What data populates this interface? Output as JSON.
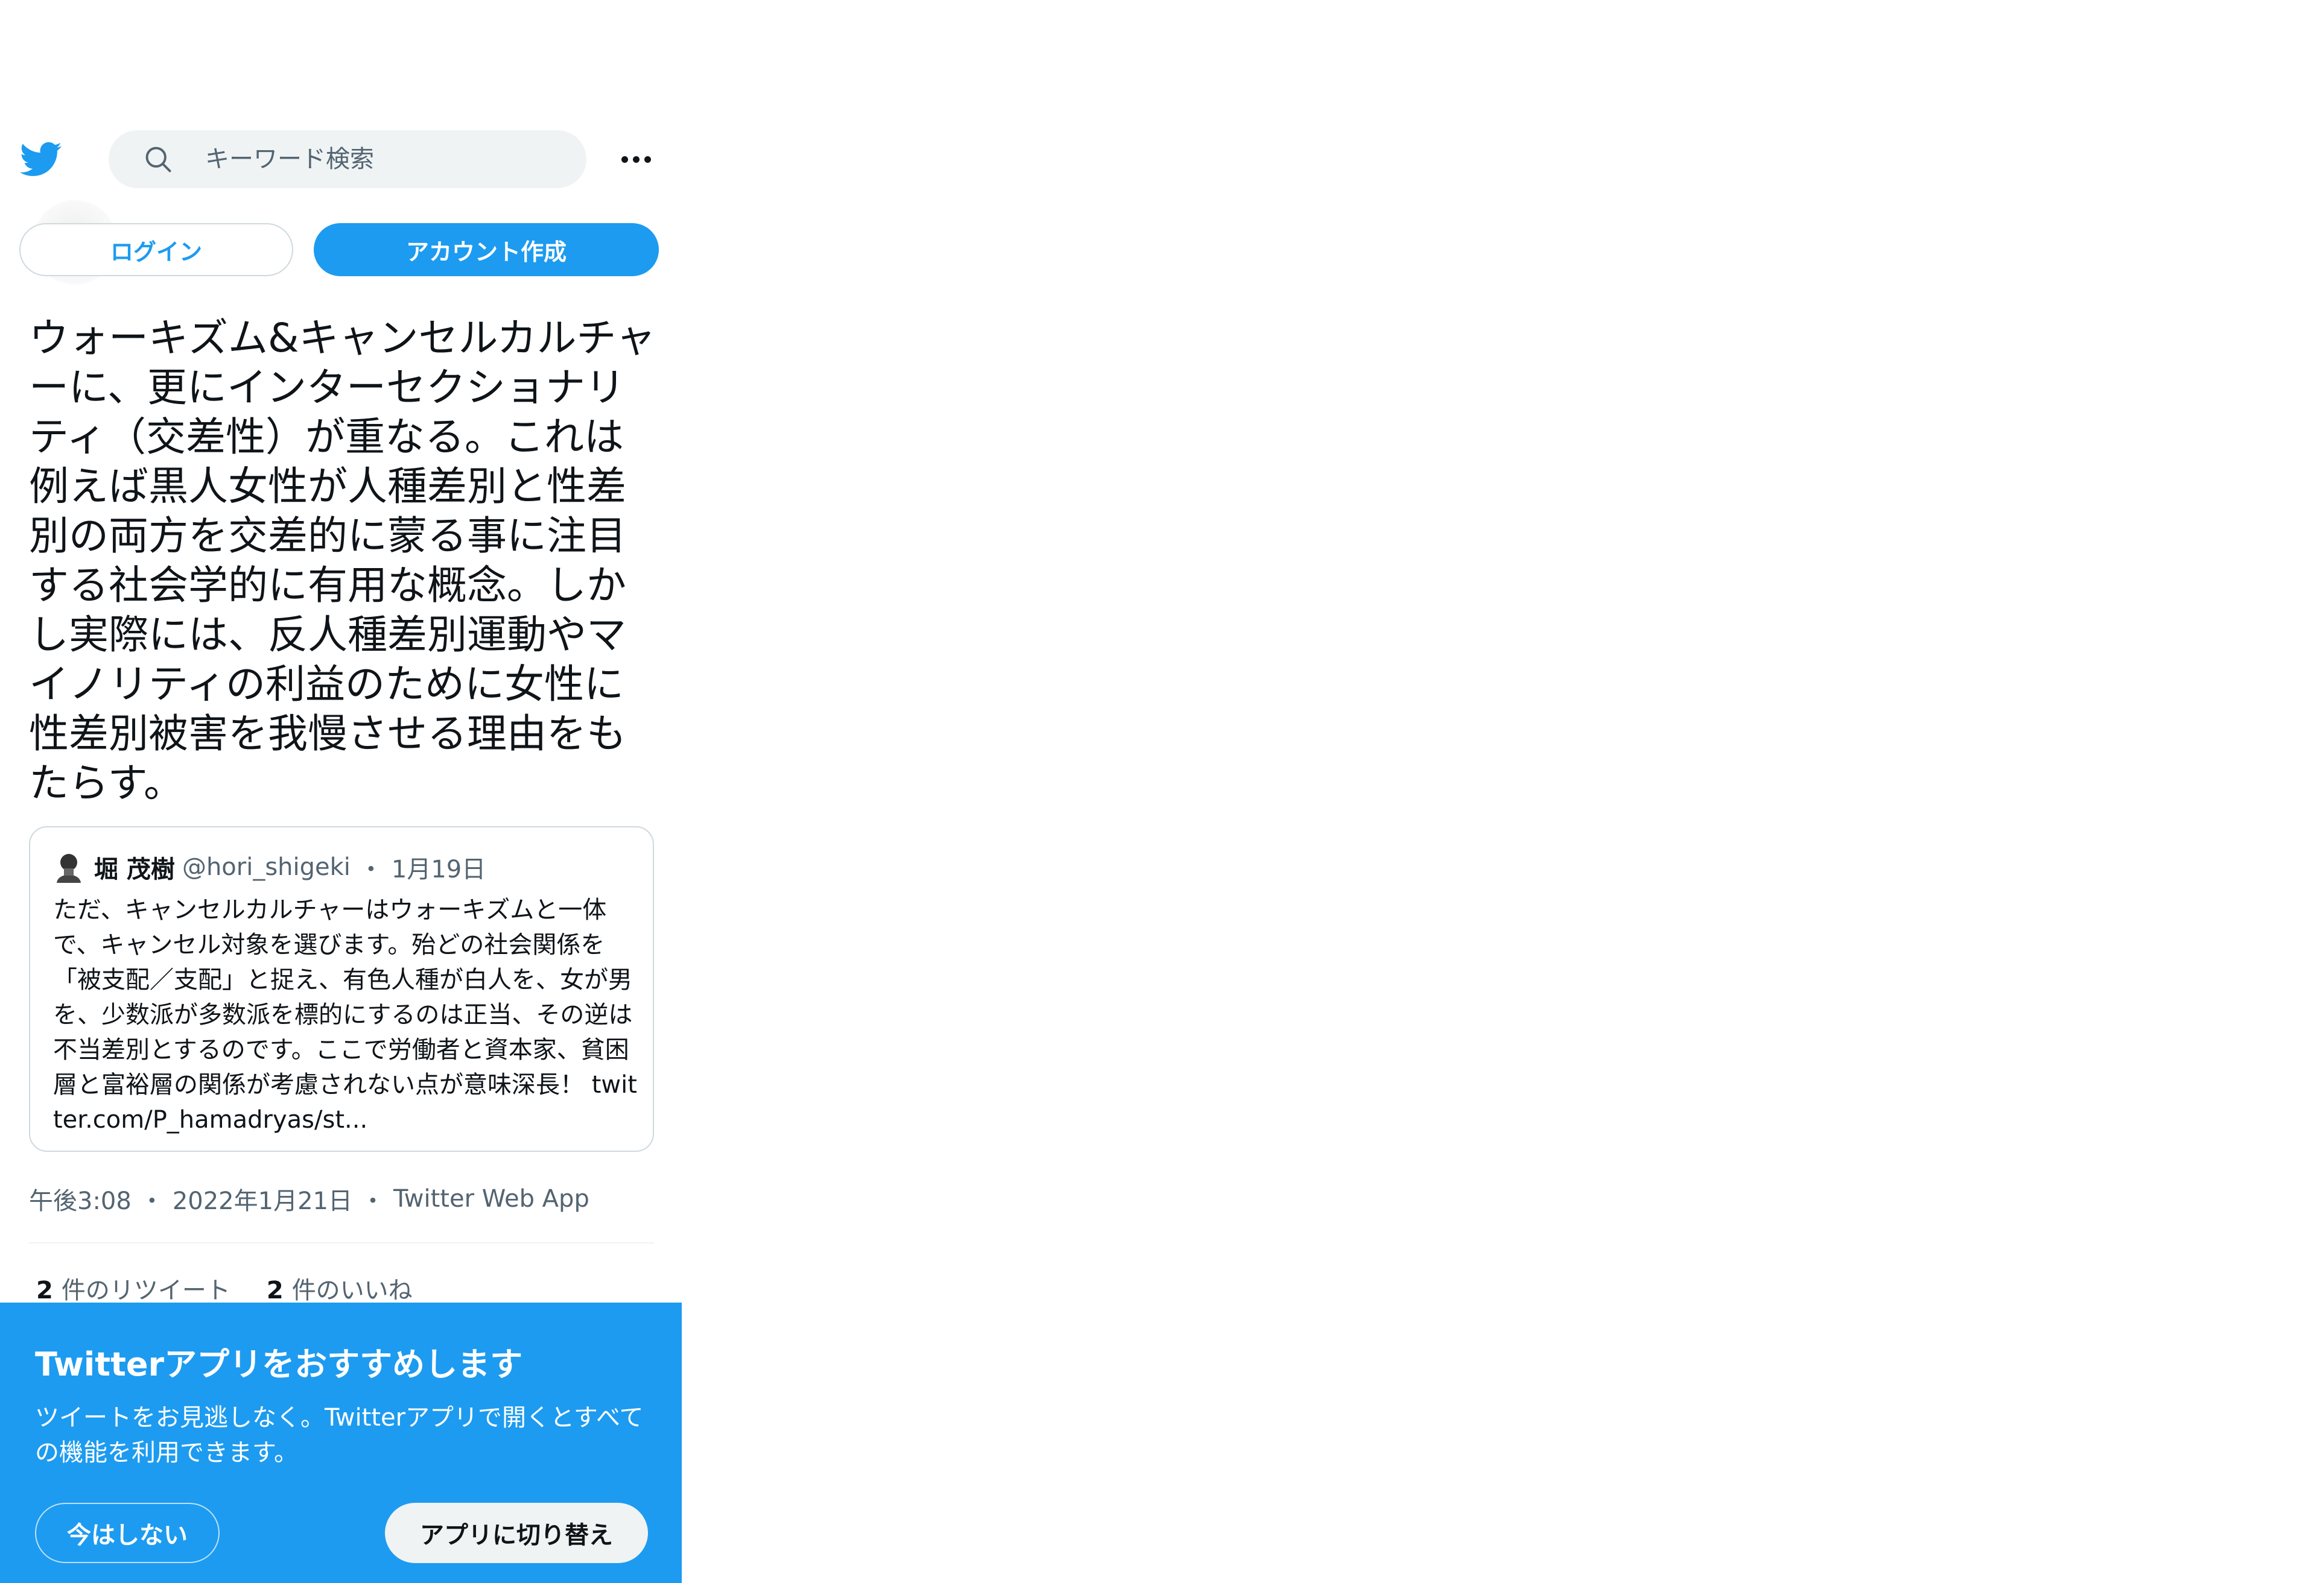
{
  "header": {
    "search_placeholder": "キーワード検索"
  },
  "auth": {
    "login_label": "ログイン",
    "signup_label": "アカウント作成"
  },
  "tweet": {
    "text": "ウォーキズム&キャンセルカルチャーに、更にインターセクショナリティ（交差性）が重なる。これは例えば黒人女性が人種差別と性差別の両方を交差的に蒙る事に注目する社会学的に有用な概念。しかし実際には、反人種差別運動やマイノリティの利益のために女性に性差別被害を我慢させる理由をもたらす。",
    "quote": {
      "name": "堀 茂樹",
      "handle": "@hori_shigeki",
      "separator": "・",
      "date": "1月19日",
      "text": "ただ、キャンセルカルチャーはウォーキズムと一体で、キャンセル対象を選びます。殆どの社会関係を「被支配／支配」と捉え、有色人種が白人を、女が男を、少数派が多数派を標的にするのは正当、その逆は不当差別とするのです。ここで労働者と資本家、貧困層と富裕層の関係が考慮されない点が意味深長！ twitter.com/P_hamadryas/st..."
    },
    "time": "午後3:08",
    "date": "2022年1月21日",
    "separator": "・",
    "source": "Twitter Web App",
    "retweet_count": "2",
    "retweet_label": "件のリツイート",
    "like_count": "2",
    "like_label": "件のいいね"
  },
  "app_banner": {
    "title": "Twitterアプリをおすすめします",
    "body": "ツイートをお見逃しなく。Twitterアプリで開くとすべての機能を利用できます。",
    "not_now_label": "今はしない",
    "switch_label": "アプリに切り替え"
  },
  "colors": {
    "brand": "#1d9bf0",
    "text": "#0f1419",
    "secondary": "#536471"
  },
  "icons": {
    "logo": "twitter-bird-icon",
    "search": "search-icon",
    "more": "more-icon"
  }
}
